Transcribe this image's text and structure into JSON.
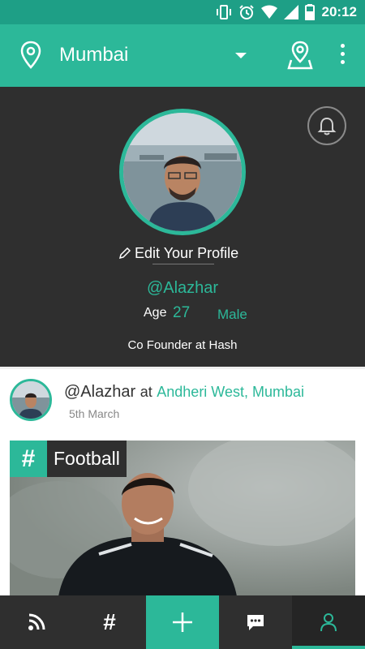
{
  "status_bar": {
    "time": "20:12",
    "icons": [
      "vibrate-icon",
      "alarm-icon",
      "wifi-icon",
      "signal-icon",
      "battery-icon"
    ]
  },
  "app_bar": {
    "city": "Mumbai",
    "icons": [
      "location-pin-icon",
      "dropdown-caret-icon",
      "map-pin-icon",
      "more-vert-icon"
    ]
  },
  "profile": {
    "edit_label": "Edit Your Profile",
    "handle": "@Alazhar",
    "age_label": "Age",
    "age_value": "27",
    "gender": "Male",
    "bio": "Co Founder at Hash"
  },
  "post": {
    "author": "@Alazhar",
    "at_word": "at",
    "place": "Andheri West, Mumbai",
    "date": "5th March",
    "tag_symbol": "#",
    "tag": "Football"
  },
  "bottom_nav": {
    "items": [
      {
        "icon": "rss-feed-icon"
      },
      {
        "icon": "hash-icon",
        "symbol": "#"
      },
      {
        "icon": "plus-icon"
      },
      {
        "icon": "chat-icon"
      },
      {
        "icon": "profile-icon",
        "active": true
      }
    ]
  },
  "colors": {
    "accent": "#2cb899",
    "status_bar": "#1e9f86",
    "dark_bg": "#2f2f2f",
    "card_bg": "#ffffff"
  }
}
